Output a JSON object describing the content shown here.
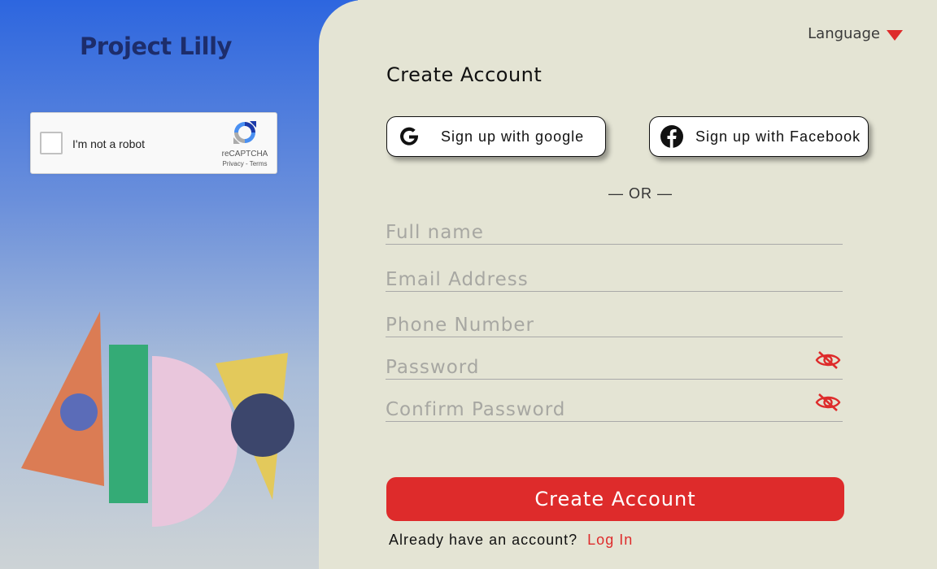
{
  "brand": {
    "title": "Project Lilly"
  },
  "recaptcha": {
    "label": "I'm not a robot",
    "brand": "reCAPTCHA",
    "links": "Privacy - Terms"
  },
  "language": {
    "label": "Language"
  },
  "form": {
    "heading": "Create Account",
    "google_label": "Sign up with google",
    "facebook_label": "Sign up with Facebook",
    "separator": "— OR —",
    "fields": {
      "full_name": {
        "placeholder": "Full name",
        "value": ""
      },
      "email": {
        "placeholder": "Email Address",
        "value": ""
      },
      "phone": {
        "placeholder": "Phone Number",
        "value": ""
      },
      "password": {
        "placeholder": "Password",
        "value": ""
      },
      "confirm_password": {
        "placeholder": "Confirm Password",
        "value": ""
      }
    },
    "submit_label": "Create Account",
    "login_prompt": "Already have an account?",
    "login_link": "Log In"
  },
  "colors": {
    "accent": "#de2b2b",
    "panel_bg": "#e4e4d4",
    "brand_text": "#1d2d6b",
    "gradient_top": "#2d66df",
    "gradient_bottom": "#cdd3d6"
  },
  "icons": {
    "google": "google-g-icon",
    "facebook": "facebook-icon",
    "password_toggle": "eye-slash-icon",
    "language_dropdown": "caret-down-icon",
    "recaptcha": "recaptcha-icon"
  }
}
